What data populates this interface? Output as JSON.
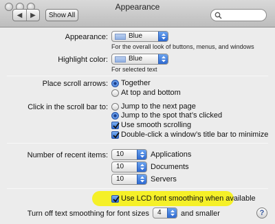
{
  "window": {
    "title": "Appearance",
    "toolbar": {
      "back_glyph": "◀",
      "forward_glyph": "▶",
      "show_all_label": "Show All"
    },
    "search": {
      "value": ""
    }
  },
  "appearance": {
    "label": "Appearance:",
    "value": "Blue",
    "hint": "For the overall look of buttons, menus, and windows"
  },
  "highlight": {
    "label": "Highlight color:",
    "value": "Blue",
    "hint": "For selected text"
  },
  "scroll_arrows": {
    "label": "Place scroll arrows:",
    "options": [
      {
        "label": "Together",
        "selected": true
      },
      {
        "label": "At top and bottom",
        "selected": false
      }
    ]
  },
  "scroll_click": {
    "label": "Click in the scroll bar to:",
    "options": [
      {
        "label": "Jump to the next page",
        "selected": false
      },
      {
        "label": "Jump to the spot that’s clicked",
        "selected": true
      }
    ],
    "smooth_scrolling": {
      "label": "Use smooth scrolling",
      "checked": true
    },
    "double_click_minimize": {
      "label": "Double-click a window’s title bar to minimize",
      "checked": true
    }
  },
  "recent_items": {
    "label": "Number of recent items:",
    "rows": [
      {
        "value": "10",
        "label": "Applications"
      },
      {
        "value": "10",
        "label": "Documents"
      },
      {
        "value": "10",
        "label": "Servers"
      }
    ]
  },
  "font_smoothing": {
    "lcd": {
      "label": "Use LCD font smoothing when available",
      "checked": true
    },
    "turn_off_label": "Turn off text smoothing for font sizes",
    "size_value": "4",
    "suffix": "and smaller"
  },
  "help": {
    "label": "?"
  },
  "colors": {
    "accent": "#2f6bcf",
    "highlight_marker": "#f6f01d",
    "window_bg": "#ececec"
  }
}
